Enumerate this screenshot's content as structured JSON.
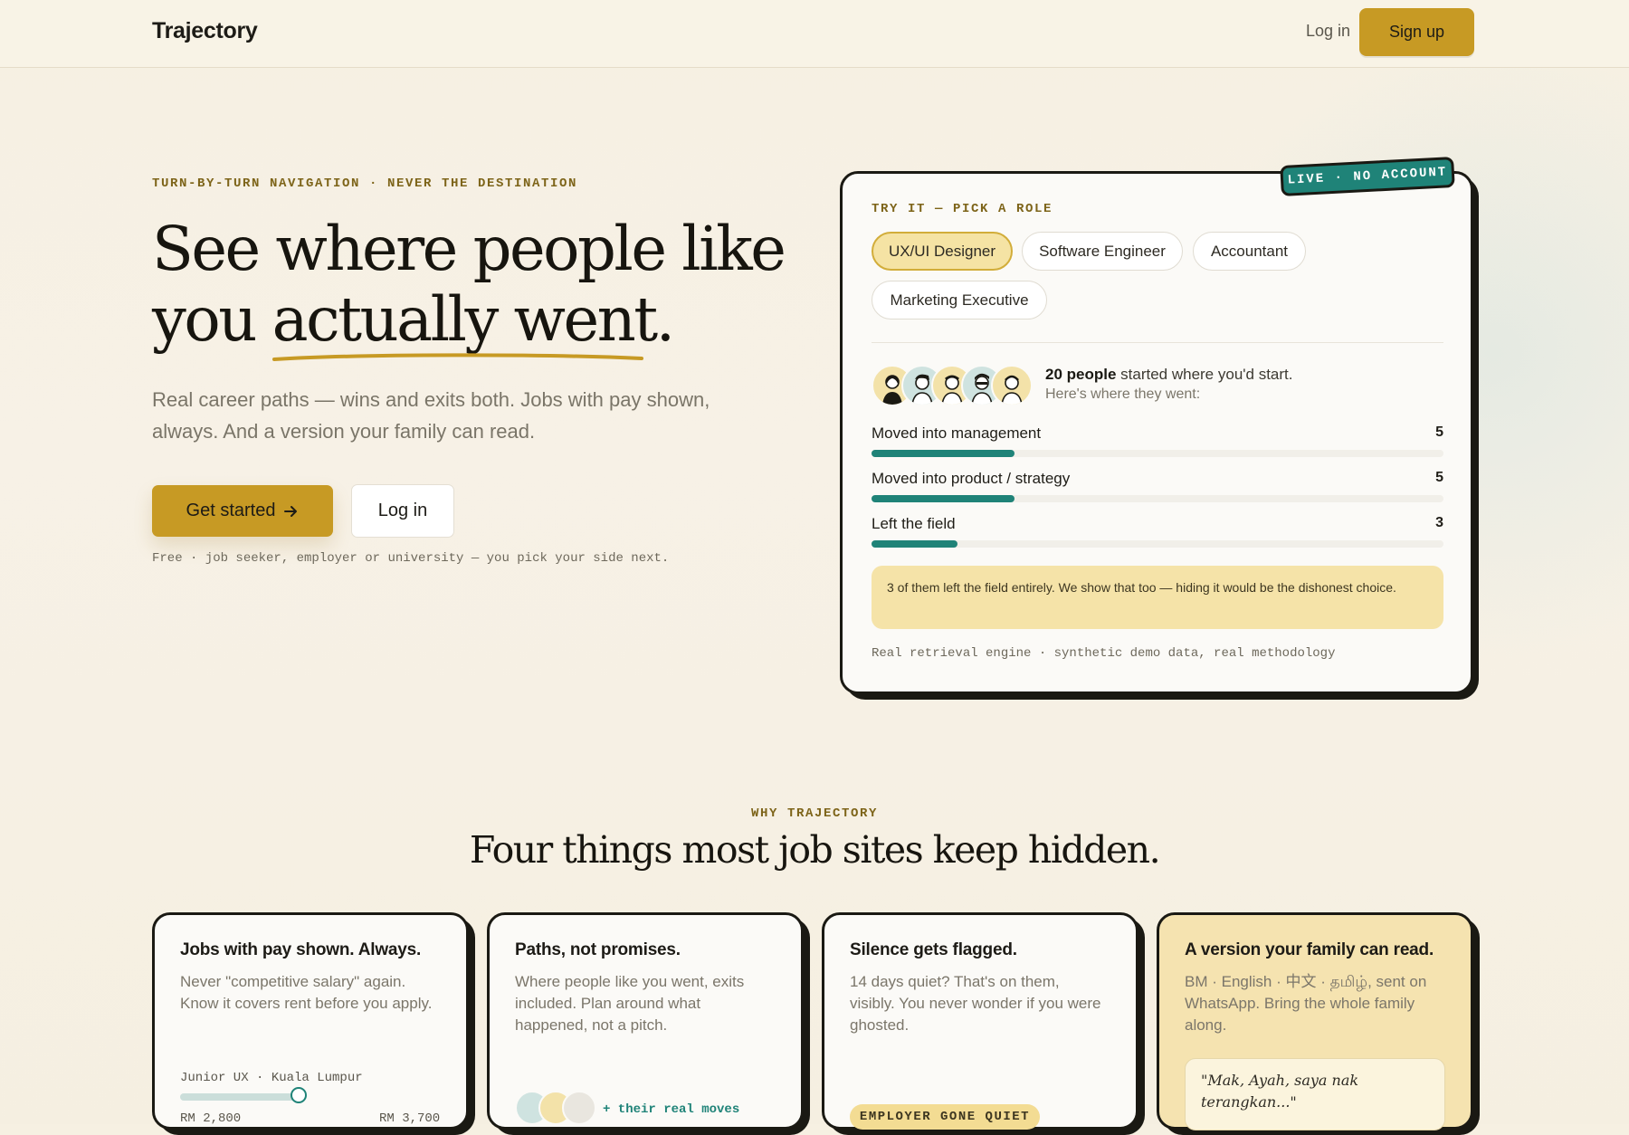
{
  "header": {
    "brand": "Trajectory",
    "login": "Log in",
    "signup": "Sign up"
  },
  "hero": {
    "eyebrow": "TURN-BY-TURN NAVIGATION · NEVER THE DESTINATION",
    "title_line1": "See where people like",
    "title_line2_prefix": "you ",
    "title_line2_underlined": "actually went.",
    "subtitle": "Real career paths — wins and exits both. Jobs with pay shown, always. And a version your family can read.",
    "cta_primary": "Get started",
    "cta_secondary": "Log in",
    "note": "Free · job seeker, employer or university — you pick your side next."
  },
  "demo": {
    "tag": "LIVE · NO ACCOUNT",
    "eyebrow": "TRY IT — PICK A ROLE",
    "roles": [
      "UX/UI Designer",
      "Software Engineer",
      "Accountant",
      "Marketing Executive"
    ],
    "selected_role": "UX/UI Designer",
    "people_count": "20 people",
    "people_text": " started where you'd start.",
    "people_sub": "Here's where they went:",
    "stats": [
      {
        "label": "Moved into management",
        "value": 5
      },
      {
        "label": "Moved into product / strategy",
        "value": 5
      },
      {
        "label": "Left the field",
        "value": 3
      }
    ],
    "stats_total": 20,
    "callout": "3 of them left the field entirely. We show that too — hiding it would be the dishonest choice.",
    "footnote": "Real retrieval engine · synthetic demo data, real methodology"
  },
  "why": {
    "eyebrow": "WHY TRAJECTORY",
    "title": "Four things most job sites keep hidden.",
    "cards": [
      {
        "title": "Jobs with pay shown. Always.",
        "body": "Never \"competitive salary\" again. Know it covers rent before you apply.",
        "meta": "Junior UX · Kuala Lumpur",
        "salary_low": "RM 2,800",
        "salary_high": "RM 3,700"
      },
      {
        "title": "Paths, not promises.",
        "body": "Where people like you went, exits included. Plan around what happened, not a pitch.",
        "meta": "+ their real moves"
      },
      {
        "title": "Silence gets flagged.",
        "body": "14 days quiet? That's on them, visibly. You never wonder if you were ghosted.",
        "badge": "EMPLOYER GONE QUIET"
      },
      {
        "title": "A version your family can read.",
        "body": "BM · English · 中文 · தமிழ், sent on WhatsApp. Bring the whole family along.",
        "quote": "\"Mak, Ayah, saya nak terangkan...\""
      }
    ]
  },
  "colors": {
    "accent": "#c79a24",
    "teal": "#1f8378",
    "ink": "#1a1913"
  },
  "icons": {
    "cta_arrow": "arrow-right-icon"
  }
}
